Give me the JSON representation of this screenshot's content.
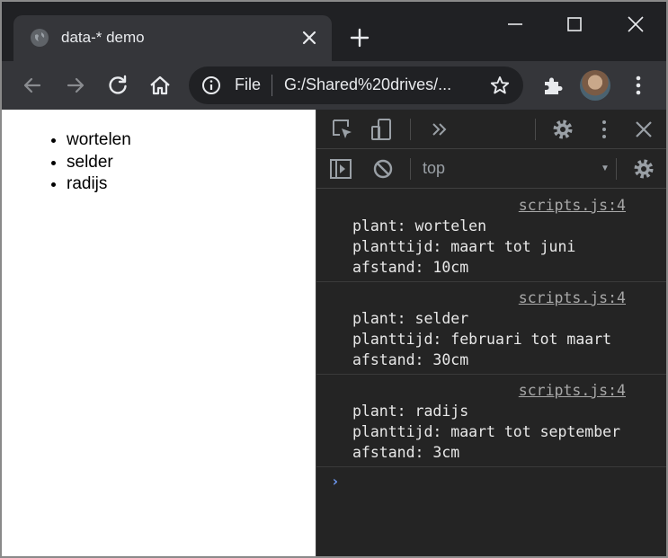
{
  "tab": {
    "title": "data-* demo"
  },
  "omnibox": {
    "scheme_label": "File",
    "url": "G:/Shared%20drives/..."
  },
  "page": {
    "list_items": [
      "wortelen",
      "selder",
      "radijs"
    ]
  },
  "devtools": {
    "context": "top",
    "messages": [
      {
        "source": "scripts.js:4",
        "lines": [
          "plant: wortelen",
          "planttijd: maart tot juni",
          "afstand: 10cm"
        ]
      },
      {
        "source": "scripts.js:4",
        "lines": [
          "plant: selder",
          "planttijd: februari tot maart",
          "afstand: 30cm"
        ]
      },
      {
        "source": "scripts.js:4",
        "lines": [
          "plant: radijs",
          "planttijd: maart tot september",
          "afstand: 3cm"
        ]
      }
    ],
    "prompt": "›"
  },
  "icons": {
    "favicon": "globe-icon",
    "tab_close": "close-icon",
    "new_tab": "plus-icon",
    "back": "arrow-left-icon",
    "forward": "arrow-right-icon",
    "reload": "reload-icon",
    "home": "home-icon",
    "info": "info-icon",
    "bookmark": "star-icon",
    "extensions": "puzzle-icon",
    "menu": "kebab-icon"
  },
  "colors": {
    "chrome_dark": "#202124",
    "toolbar": "#35363a",
    "devtools_bg": "#242424",
    "prompt_accent": "#6f9bf5"
  }
}
